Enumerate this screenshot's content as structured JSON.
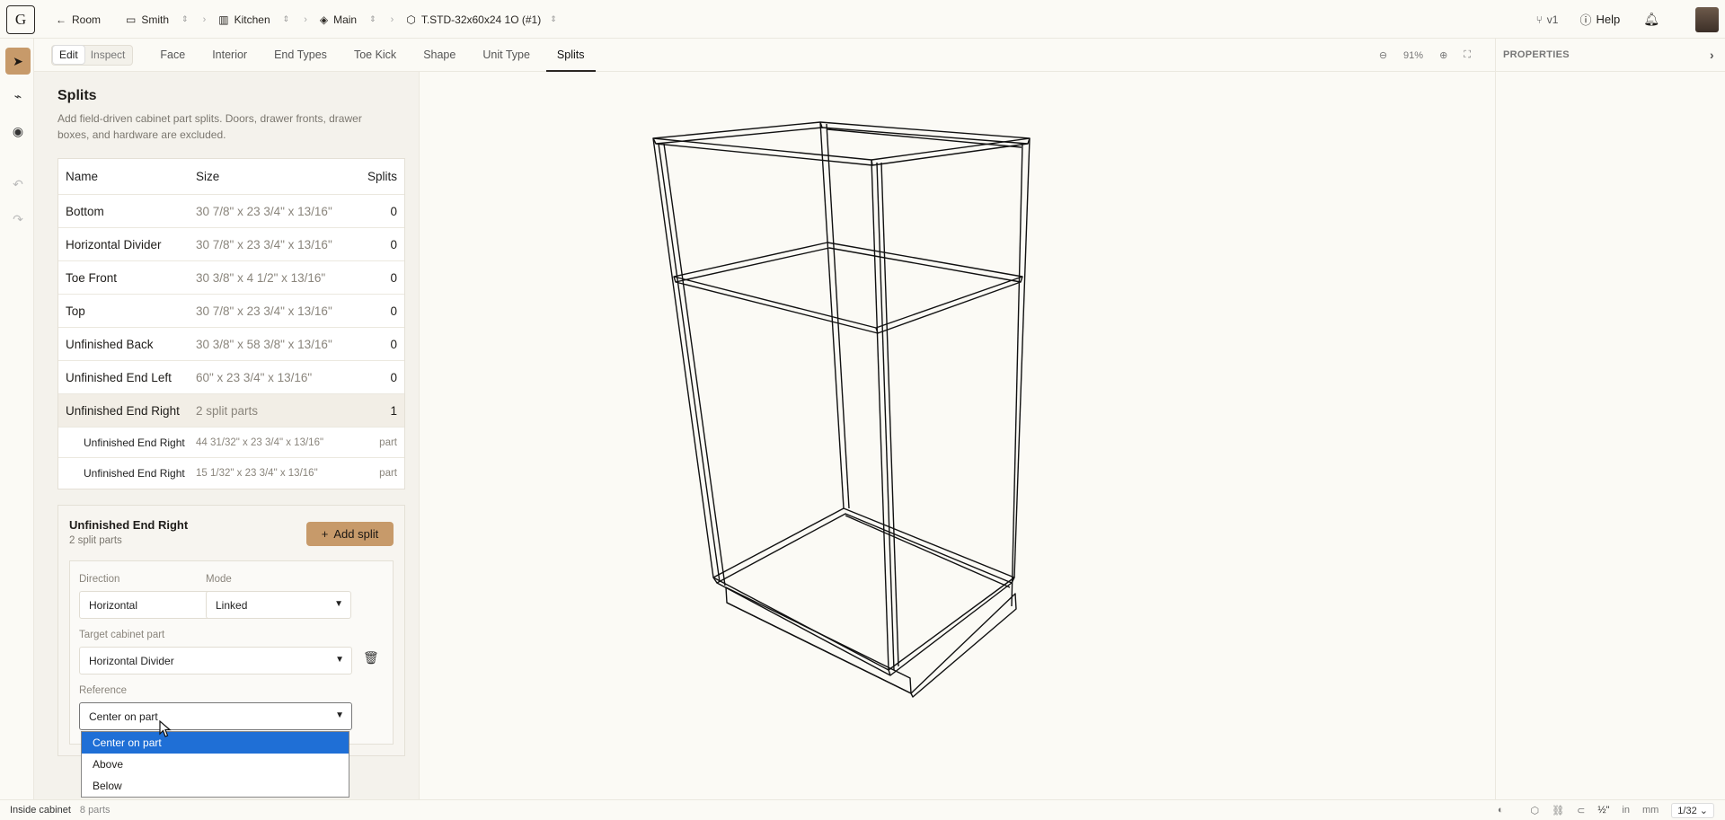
{
  "app": {
    "logo_letter": "G"
  },
  "breadcrumb": {
    "back": "Room",
    "items": [
      {
        "label": "Smith",
        "icon": "folder-icon"
      },
      {
        "label": "Kitchen",
        "icon": "building-icon"
      },
      {
        "label": "Main",
        "icon": "layers-icon"
      },
      {
        "label": "T.STD-32x60x24 1O (#1)",
        "icon": "cube-icon"
      }
    ]
  },
  "header_right": {
    "version": "v1",
    "help": "Help"
  },
  "mode_toggle": {
    "edit": "Edit",
    "inspect": "Inspect"
  },
  "tabs": [
    "Face",
    "Interior",
    "End Types",
    "Toe Kick",
    "Shape",
    "Unit Type",
    "Splits"
  ],
  "active_tab": "Splits",
  "zoom": {
    "level": "91%"
  },
  "properties": {
    "title": "PROPERTIES"
  },
  "panel": {
    "title": "Splits",
    "description": "Add field-driven cabinet part splits. Doors, drawer fronts, drawer boxes, and hardware are excluded.",
    "table": {
      "headers": {
        "name": "Name",
        "size": "Size",
        "splits": "Splits"
      },
      "rows": [
        {
          "name": "Bottom",
          "size": "30 7/8\" x 23 3/4\" x 13/16\"",
          "splits": "0"
        },
        {
          "name": "Horizontal Divider",
          "size": "30 7/8\" x 23 3/4\" x 13/16\"",
          "splits": "0"
        },
        {
          "name": "Toe Front",
          "size": "30 3/8\" x 4 1/2\" x 13/16\"",
          "splits": "0"
        },
        {
          "name": "Top",
          "size": "30 7/8\" x 23 3/4\" x 13/16\"",
          "splits": "0"
        },
        {
          "name": "Unfinished Back",
          "size": "30 3/8\" x 58 3/8\" x 13/16\"",
          "splits": "0"
        },
        {
          "name": "Unfinished End Left",
          "size": "60\" x 23 3/4\" x 13/16\"",
          "splits": "0"
        },
        {
          "name": "Unfinished End Right",
          "size": "2 split parts",
          "splits": "1"
        }
      ],
      "subrows": [
        {
          "name": "Unfinished End Right",
          "size": "44 31/32\" x 23 3/4\" x 13/16\"",
          "tag": "part"
        },
        {
          "name": "Unfinished End Right",
          "size": "15 1/32\" x 23 3/4\" x 13/16\"",
          "tag": "part"
        }
      ]
    },
    "editor": {
      "title": "Unfinished End Right",
      "subtitle": "2 split parts",
      "add_button": "Add split",
      "direction_label": "Direction",
      "direction_value": "Horizontal",
      "mode_label": "Mode",
      "mode_value": "Linked",
      "target_label": "Target cabinet part",
      "target_value": "Horizontal Divider",
      "reference_label": "Reference",
      "reference_value": "Center on part",
      "reference_options": [
        "Center on part",
        "Above",
        "Below"
      ]
    }
  },
  "status": {
    "context": "Inside cabinet",
    "count": "8 parts",
    "units_a": "in",
    "units_b": "mm",
    "fraction": "½\"",
    "precision": "1/32"
  }
}
